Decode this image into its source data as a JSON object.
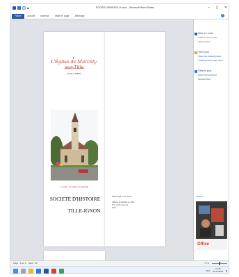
{
  "window": {
    "title": "SOCIEGLISEMORILLY.docx - Microsoft Word Starter",
    "minimize": "–",
    "maximize": "▯",
    "close": "✕"
  },
  "ribbon": {
    "tabs": [
      "Fichier",
      "Accueil",
      "Insertion",
      "Mise en page",
      "Affichage"
    ],
    "help": "?"
  },
  "document": {
    "left_page": {
      "church_title": "L'Église de Marcilly-sur-Tille",
      "commune": "Commune de Marcilly",
      "author": "Serge TRIBOT",
      "photo_caption": "La place de l'église de Marcilly",
      "society_line1": "SOCIETE D'HISTOIRE",
      "society_line2": "TILLE-IGNON"
    },
    "right_page": {
      "lines": [
        "Dépôt légal : 2e trimestre",
        "L'Église de Marcilly-sur-Tille",
        "Tous droits réservés",
        "2014"
      ]
    }
  },
  "side_pane": {
    "sections": [
      {
        "heading": "Mise en route",
        "links": [
          "Guide de mise en route",
          "Aide et support"
        ]
      },
      {
        "heading": "Votre plus",
        "links": [
          "Obtenir des modèles gratuits",
          "Télécharger des images clipart"
        ]
      },
      {
        "heading": "Obtenir plus",
        "links": [
          "Obtenir Microsoft Word",
          "Microsoft Office"
        ]
      }
    ],
    "ad_label": "Publicité",
    "ad_logo": "Office"
  },
  "status_bar": {
    "page": "Page : 1 sur 2",
    "words": "Mots : 65",
    "zoom": "70 %"
  },
  "taskbar": {
    "language": "FRA",
    "time": "17:35",
    "date": "07/12/2015"
  },
  "colors": {
    "accent": "#2b579a",
    "church_title": "#c0392b",
    "office_logo": "#d04423"
  }
}
